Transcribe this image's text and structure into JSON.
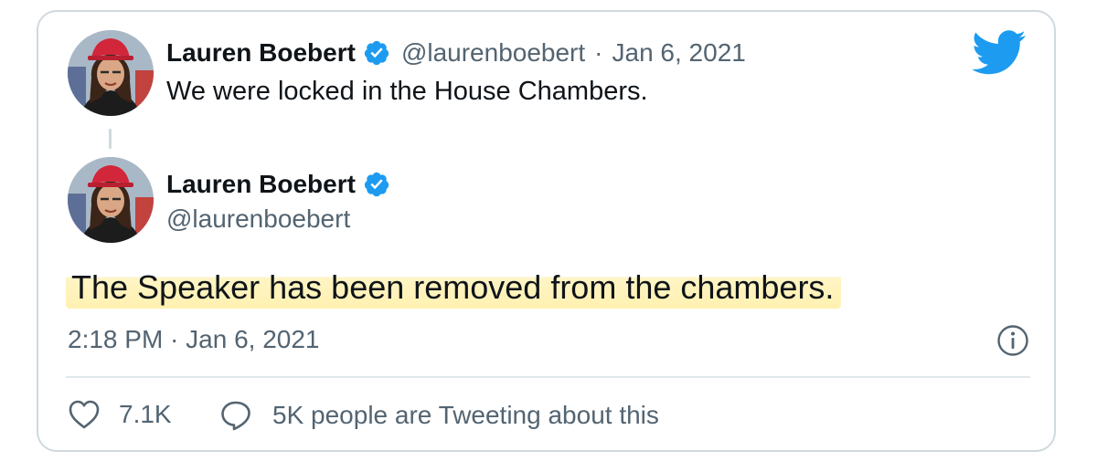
{
  "colors": {
    "twitter_blue": "#1d9bf0",
    "text_primary": "#0f1419",
    "text_secondary": "#536471",
    "border": "#cfd9de",
    "highlight": "#ffec96"
  },
  "icons": {
    "logo": "twitter-bird-icon",
    "verified": "verified-badge-icon",
    "info": "info-icon",
    "like": "heart-icon",
    "reply": "speech-bubble-icon"
  },
  "parent_tweet": {
    "display_name": "Lauren Boebert",
    "handle": "@laurenboebert",
    "separator": "·",
    "date": "Jan 6, 2021",
    "text": "We were locked in the House Chambers."
  },
  "main_tweet": {
    "display_name": "Lauren Boebert",
    "handle": "@laurenboebert",
    "text": "The Speaker has been removed from the chambers.",
    "timestamp": "2:18 PM · Jan 6, 2021",
    "likes": "7.1K",
    "engagement_text": "5K people are Tweeting about this"
  }
}
